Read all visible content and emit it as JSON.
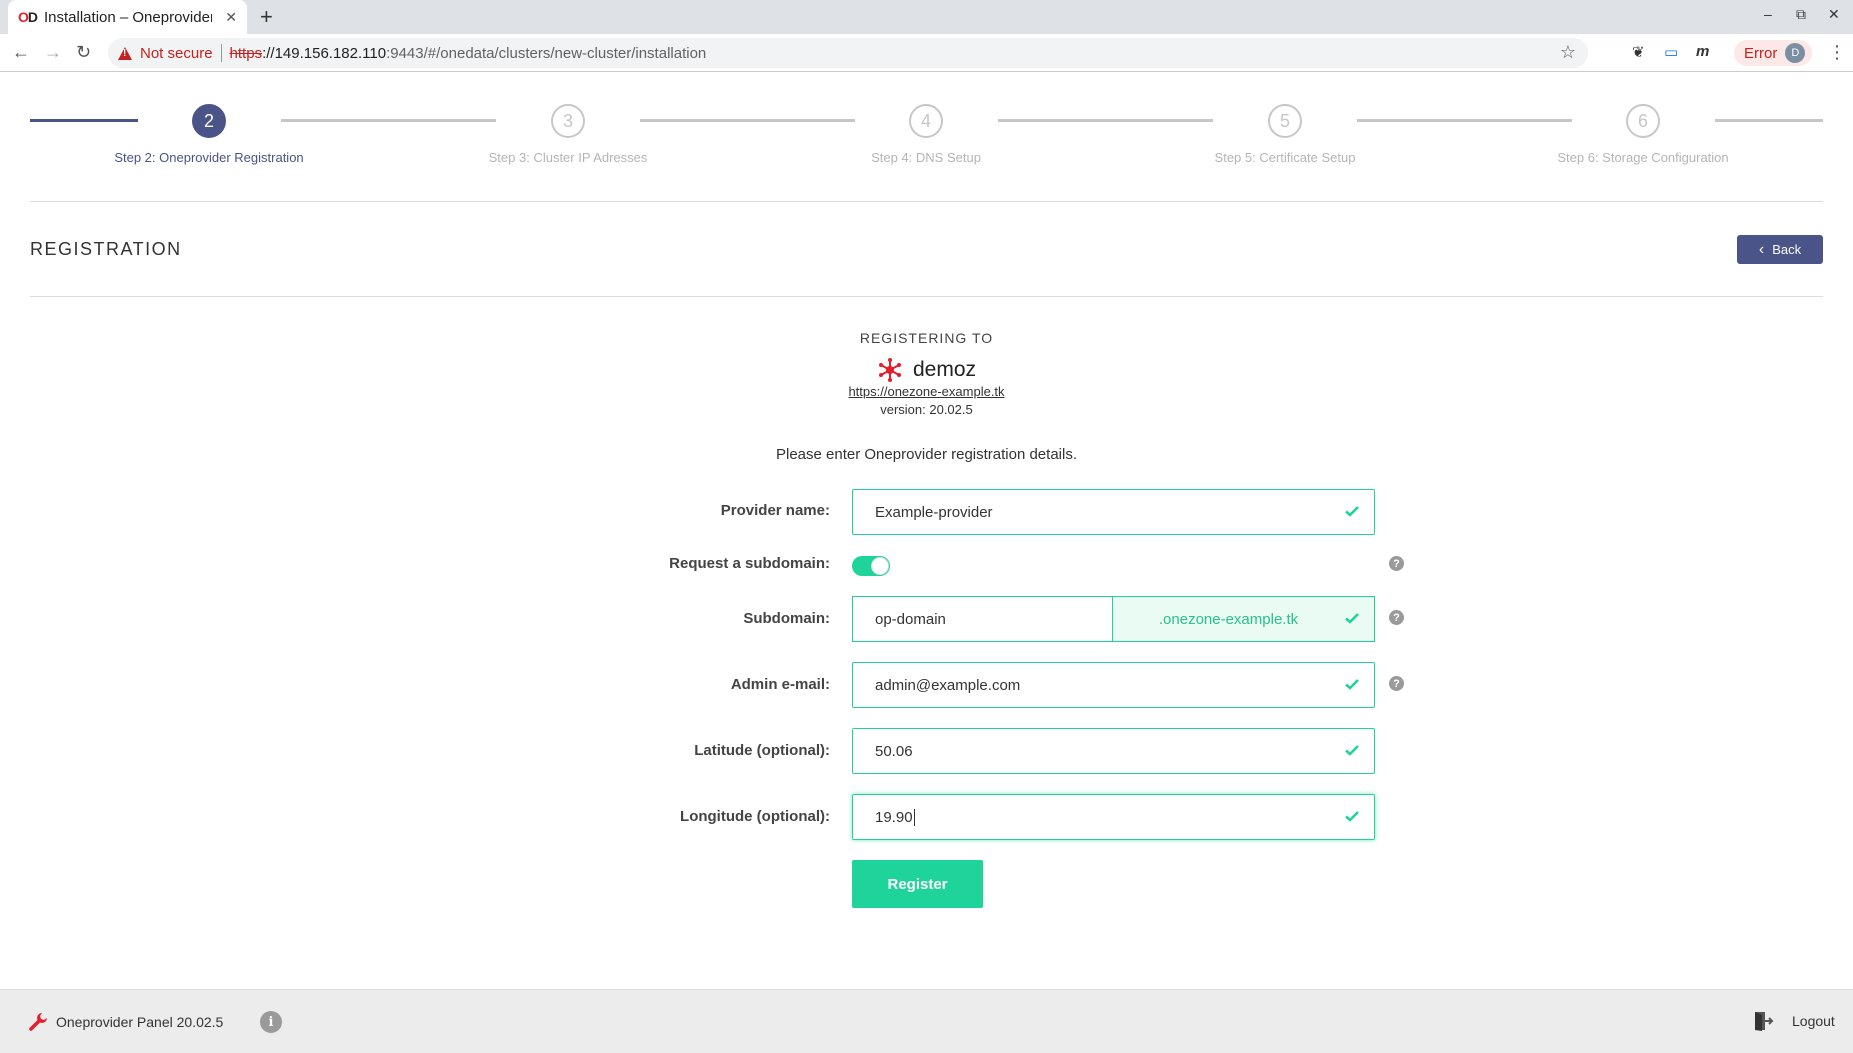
{
  "browser": {
    "tab_title": "Installation – Oneprovider Panel",
    "tab_favicon": "onedata-favicon",
    "not_secure": "Not secure",
    "url_scheme": "https",
    "url_host": "://149.156.182.110",
    "url_rest": ":9443/#/onedata/clusters/new-cluster/installation",
    "error_label": "Error",
    "avatar_letter": "D",
    "close_tab": "✕",
    "new_tab": "+",
    "minimize": "–",
    "maximize": "⧉",
    "close_window": "✕",
    "back": "←",
    "forward": "→",
    "reload": "↻",
    "star": "☆",
    "ext1": "❦",
    "ext2": "▭",
    "ext3": "m",
    "menu": "⋮"
  },
  "steps": [
    {
      "number": "2",
      "label": "Step 2: Oneprovider Registration",
      "active": true
    },
    {
      "number": "3",
      "label": "Step 3: Cluster IP Adresses",
      "active": false
    },
    {
      "number": "4",
      "label": "Step 4: DNS Setup",
      "active": false
    },
    {
      "number": "5",
      "label": "Step 5: Certificate Setup",
      "active": false
    },
    {
      "number": "6",
      "label": "Step 6: Storage Configuration",
      "active": false
    }
  ],
  "header": {
    "title": "REGISTRATION",
    "back_label": "Back"
  },
  "registering": {
    "heading": "REGISTERING TO",
    "zone_name": "demoz",
    "zone_url": "https://onezone-example.tk",
    "version": "version: 20.02.5",
    "intro": "Please enter Oneprovider registration details."
  },
  "form": {
    "provider_name_label": "Provider name:",
    "provider_name_value": "Example-provider",
    "subdomain_toggle_label": "Request a subdomain:",
    "subdomain_toggle_on": true,
    "subdomain_label": "Subdomain:",
    "subdomain_value": "op-domain",
    "subdomain_suffix": ".onezone-example.tk",
    "admin_email_label": "Admin e-mail:",
    "admin_email_value": "admin@example.com",
    "latitude_label": "Latitude (optional):",
    "latitude_value": "50.06",
    "longitude_label": "Longitude (optional):",
    "longitude_value": "19.90",
    "help_glyph": "?",
    "register_label": "Register"
  },
  "footer": {
    "brand": "Oneprovider Panel 20.02.5",
    "info_glyph": "i",
    "logout_label": "Logout"
  },
  "colors": {
    "primary": "#4a5488",
    "success": "#1fd49a",
    "brand_red": "#e41e2b"
  }
}
